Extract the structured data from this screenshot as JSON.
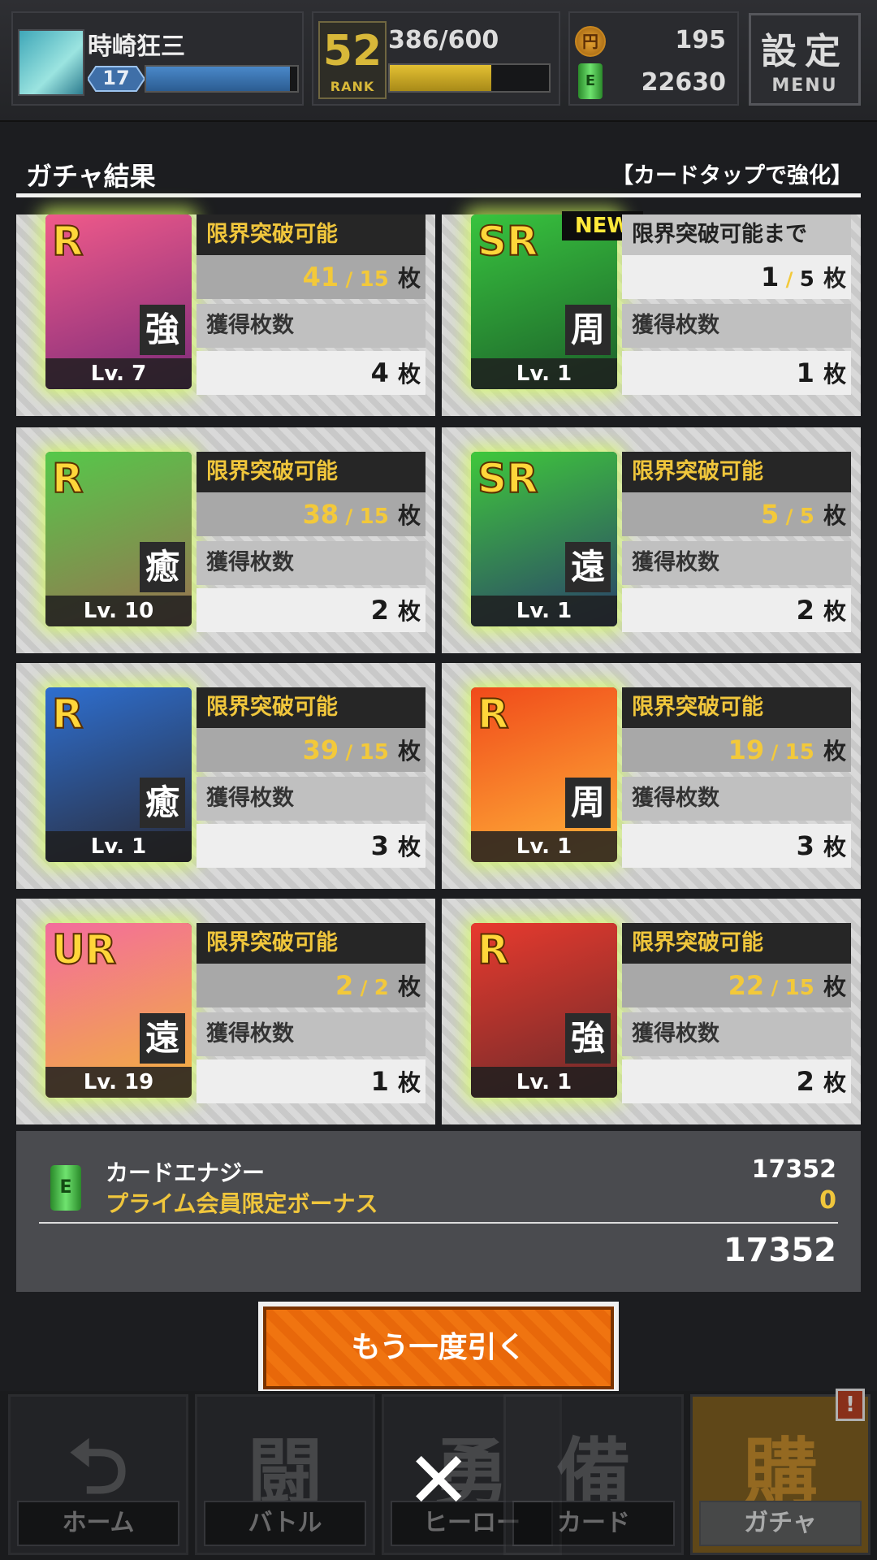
{
  "player": {
    "name": "時崎狂三",
    "level": "17",
    "exp_ratio": 0.95
  },
  "rank": {
    "num": "52",
    "label": "RANK",
    "stamina": "386/600",
    "stamina_ratio": 0.64
  },
  "currency": {
    "coin_icon": "円",
    "coin": "195",
    "energy_icon": "E",
    "energy": "22630"
  },
  "menu": {
    "kanji": "設定",
    "label": "MENU"
  },
  "section": {
    "title": "ガチャ結果",
    "hint": "【カードタップで強化】"
  },
  "cards": [
    {
      "rarity": "R",
      "type": "強",
      "level": "Lv. 7",
      "status": "限界突破可能",
      "have": "41",
      "max": "15",
      "unit": "枚",
      "got_label": "獲得枚数",
      "got": "4",
      "new": "",
      "art": [
        "#f05a8a",
        "#7b2b7a"
      ]
    },
    {
      "rarity": "SR",
      "type": "周",
      "level": "Lv. 1",
      "status": "限界突破可能まで",
      "have": "1",
      "max": "5",
      "unit": "枚",
      "got_label": "獲得枚数",
      "got": "1",
      "new": "NEW",
      "art": [
        "#38c43e",
        "#1c5e2a"
      ]
    },
    {
      "rarity": "R",
      "type": "癒",
      "level": "Lv. 10",
      "status": "限界突破可能",
      "have": "38",
      "max": "15",
      "unit": "枚",
      "got_label": "獲得枚数",
      "got": "2",
      "new": "",
      "art": [
        "#55c84a",
        "#9a7050"
      ]
    },
    {
      "rarity": "SR",
      "type": "遠",
      "level": "Lv. 1",
      "status": "限界突破可能",
      "have": "5",
      "max": "5",
      "unit": "枚",
      "got_label": "獲得枚数",
      "got": "2",
      "new": "",
      "art": [
        "#3fc83b",
        "#2a3f6b"
      ]
    },
    {
      "rarity": "R",
      "type": "癒",
      "level": "Lv. 1",
      "status": "限界突破可能",
      "have": "39",
      "max": "15",
      "unit": "枚",
      "got_label": "獲得枚数",
      "got": "3",
      "new": "",
      "art": [
        "#2e6fd0",
        "#2a2a36"
      ]
    },
    {
      "rarity": "R",
      "type": "周",
      "level": "Lv. 1",
      "status": "限界突破可能",
      "have": "19",
      "max": "15",
      "unit": "枚",
      "got_label": "獲得枚数",
      "got": "3",
      "new": "",
      "art": [
        "#f04a1a",
        "#ffb43a"
      ]
    },
    {
      "rarity": "UR",
      "type": "遠",
      "level": "Lv. 19",
      "status": "限界突破可能",
      "have": "2",
      "max": "2",
      "unit": "枚",
      "got_label": "獲得枚数",
      "got": "1",
      "new": "",
      "art": [
        "#f36c9d",
        "#f2b33a"
      ]
    },
    {
      "rarity": "R",
      "type": "強",
      "level": "Lv. 1",
      "status": "限界突破可能",
      "have": "22",
      "max": "15",
      "unit": "枚",
      "got_label": "獲得枚数",
      "got": "2",
      "new": "",
      "art": [
        "#e83a2e",
        "#6a2a2a"
      ]
    }
  ],
  "summary": {
    "icon": "E",
    "line1": "カードエナジー",
    "line2": "プライム会員限定ボーナス",
    "val1": "17352",
    "val2": "0",
    "total": "17352"
  },
  "again_button": "もう一度引く",
  "nav": [
    {
      "glyph": "⮌",
      "label": "ホーム"
    },
    {
      "glyph": "闘",
      "label": "バトル"
    },
    {
      "glyph": "勇",
      "label": "ヒーロー"
    },
    {
      "glyph": "備",
      "label": "カード"
    },
    {
      "glyph": "購",
      "label": "ガチャ"
    }
  ],
  "nav_alert": "!",
  "close": "✕"
}
